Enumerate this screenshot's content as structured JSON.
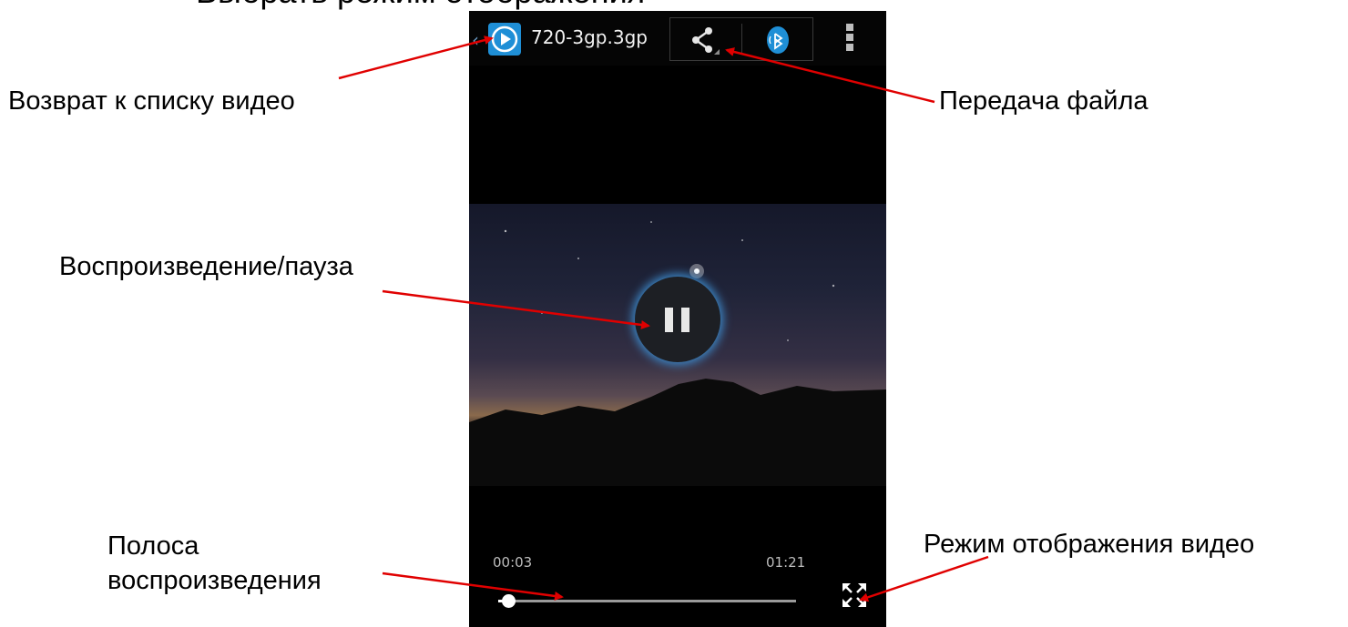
{
  "slide": {
    "title": "Выбрать режим отображения"
  },
  "callouts": {
    "back": "Возврат к списку видео",
    "share": "Передача файла",
    "play_pause": "Воспроизведение/пауза",
    "seekbar_line1": "Полоса",
    "seekbar_line2": "воспроизведения",
    "display_mode": "Режим отображения видео"
  },
  "player": {
    "file_name": "720-3gp.3gp",
    "back_glyph": "‹",
    "icons": {
      "app": "play-circle-icon",
      "share": "share-icon",
      "bluetooth": "bluetooth-icon",
      "overflow": "overflow-menu-icon",
      "pause": "pause-icon",
      "fullscreen": "fullscreen-icon"
    },
    "current_time": "00:03",
    "total_time": "01:21",
    "progress_fraction": 0.037
  },
  "colors": {
    "accent_blue": "#1f8fd6",
    "arrow_red": "#e00000",
    "screen_bg": "#000000"
  }
}
